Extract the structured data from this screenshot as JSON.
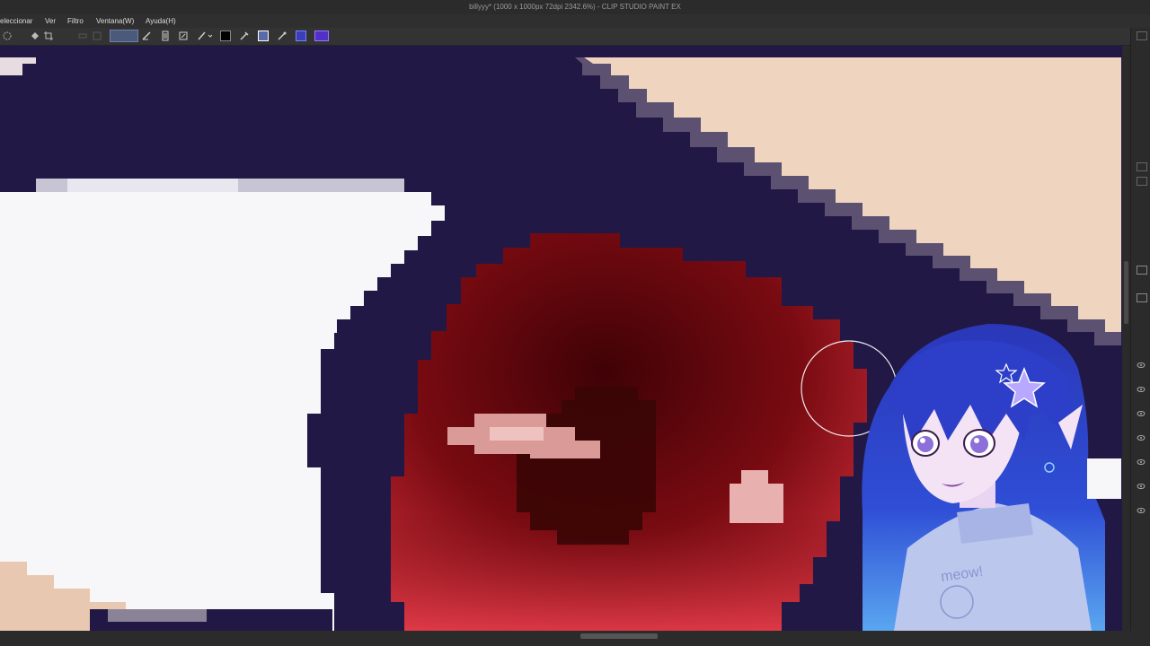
{
  "window": {
    "title": "billyyy* (1000 x 1000px 72dpi 2342.6%) - CLIP STUDIO PAINT EX"
  },
  "menu": {
    "items": [
      "eleccionar",
      "Ver",
      "Filtro",
      "Ventana(W)",
      "Ayuda(H)"
    ]
  },
  "toolbar": {
    "icons": [
      "snap-icon",
      "fill-icon",
      "crop-icon",
      "ruler-icon",
      "ruler2-icon",
      "brush-stroke-icon",
      "brush-stroke-active-icon",
      "pen-tool-icon",
      "layer-icon",
      "transform-icon",
      "pen-dropdown-icon",
      "color-swatch-icon",
      "eyedropper-icon",
      "lasso-icon",
      "selection-icon",
      "ruler-tool-icon"
    ],
    "active_color": "#000000"
  },
  "canvas": {
    "colors": {
      "skin": "#efd5bf",
      "outline": "#221845",
      "white": "#f7f6f8",
      "iris_dark": "#6a0a10",
      "iris_light": "#c9202c",
      "pupil": "#3a0606"
    }
  },
  "streamer_overlay": {
    "shirt_text": "meow!"
  }
}
